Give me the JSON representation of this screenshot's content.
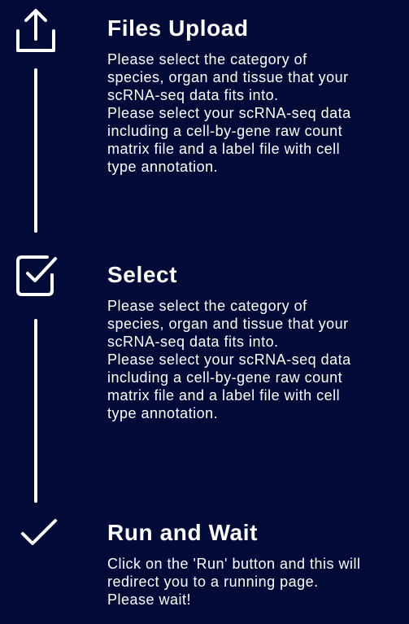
{
  "steps": [
    {
      "icon": "upload-icon",
      "title": "Files Upload",
      "description": "Please select the category of\nspecies, organ and tissue that your\nscRNA-seq data fits into.\nPlease select your scRNA-seq data\nincluding a cell-by-gene raw count\nmatrix file and a label file with cell\ntype annotation."
    },
    {
      "icon": "checkbox-checked-icon",
      "title": "Select",
      "description": "Please select the category of\nspecies, organ and tissue that your\nscRNA-seq data fits into.\nPlease select your scRNA-seq data\nincluding a cell-by-gene raw count\nmatrix file and a label file with cell\ntype annotation."
    },
    {
      "icon": "checkmark-icon",
      "title": "Run and Wait",
      "description": "Click on the 'Run' button and this will\nredirect you to a running page.\nPlease wait!"
    }
  ],
  "colors": {
    "background": "#020a38",
    "foreground": "#ffffff"
  }
}
